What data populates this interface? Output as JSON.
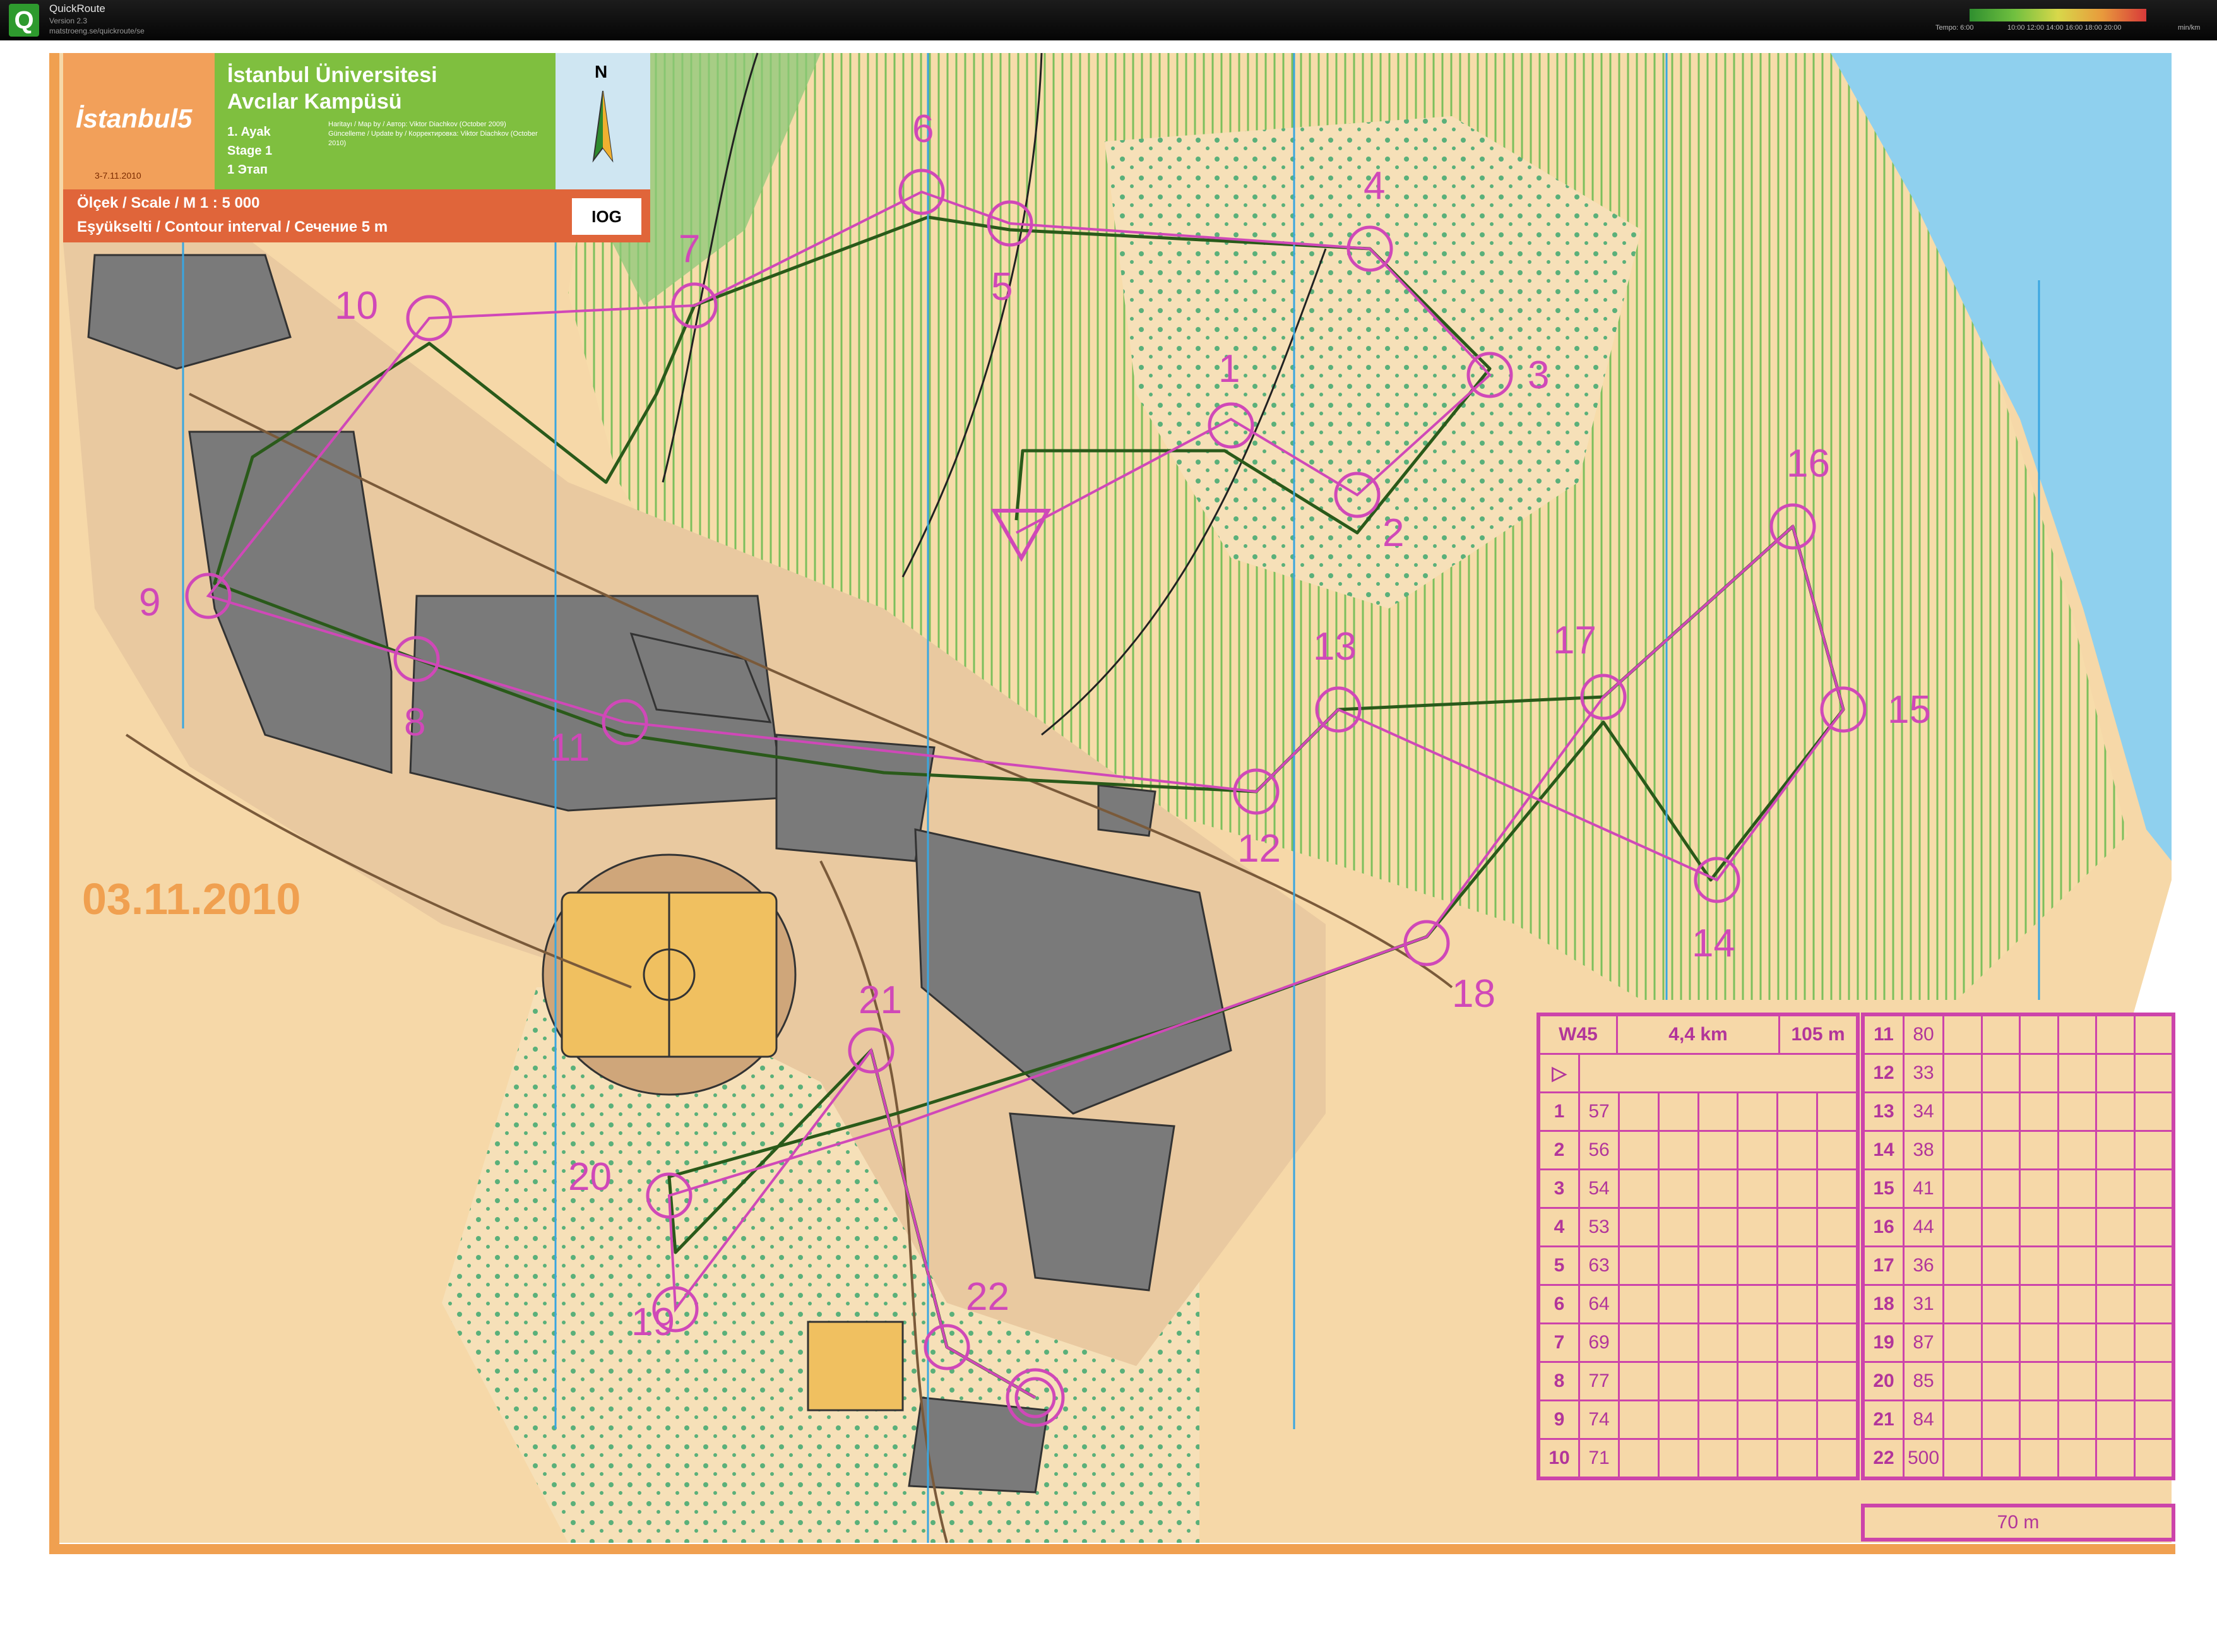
{
  "app": {
    "logo": "Q",
    "title": "QuickRoute",
    "version": "Version 2.3",
    "url": "matstroeng.se/quickroute/se",
    "pace_label": "Tempo: 6:00",
    "pace_ticks": "10:00 12:00 14:00 16:00 18:00 20:00",
    "pace_unit": "min/km"
  },
  "title_block": {
    "event_logo_text": "İstanbul5",
    "event_logo_dates": "3-7.11.2010",
    "map_title_line1": "İstanbul Üniversitesi",
    "map_title_line2": "Avcılar Kampüsü",
    "stage_line1": "1. Ayak",
    "stage_line2": "Stage 1",
    "stage_line3": "1 Этап",
    "credits_line1": "Haritayı / Map by / Автор: Viktor Diachkov (October 2009)",
    "credits_line2": "Güncelleme / Update by / Корректировка: Viktor Diachkov (October 2010)",
    "north_letter": "N",
    "scale_label": "Ölçek / Scale / M   1 : 5 000",
    "contour_label": "Eşyükselti / Contour interval / Сечение   5 m",
    "sponsor": "IOG"
  },
  "map_date": "03.11.2010",
  "colors": {
    "course": "#d048b8",
    "route": "#2a5a1a",
    "building": "#7a7a7a",
    "field": "#f0c060",
    "open_land": "#f6d8a8",
    "forest_green": "#8cc878",
    "water": "#7fc8ec",
    "border_orange": "#f0a050"
  },
  "controls": [
    {
      "label": "1"
    },
    {
      "label": "2"
    },
    {
      "label": "3"
    },
    {
      "label": "4"
    },
    {
      "label": "5"
    },
    {
      "label": "6"
    },
    {
      "label": "7"
    },
    {
      "label": "8"
    },
    {
      "label": "9"
    },
    {
      "label": "10"
    },
    {
      "label": "11"
    },
    {
      "label": "12"
    },
    {
      "label": "13"
    },
    {
      "label": "14"
    },
    {
      "label": "15"
    },
    {
      "label": "16"
    },
    {
      "label": "17"
    },
    {
      "label": "18"
    },
    {
      "label": "19"
    },
    {
      "label": "20"
    },
    {
      "label": "21"
    },
    {
      "label": "22"
    }
  ],
  "description": {
    "class": "W45",
    "length": "4,4 km",
    "climb": "105 m",
    "rows_left": [
      {
        "no": "1",
        "code": "57"
      },
      {
        "no": "2",
        "code": "56"
      },
      {
        "no": "3",
        "code": "54"
      },
      {
        "no": "4",
        "code": "53"
      },
      {
        "no": "5",
        "code": "63"
      },
      {
        "no": "6",
        "code": "64"
      },
      {
        "no": "7",
        "code": "69"
      },
      {
        "no": "8",
        "code": "77"
      },
      {
        "no": "9",
        "code": "74"
      },
      {
        "no": "10",
        "code": "71"
      }
    ],
    "rows_right": [
      {
        "no": "11",
        "code": "80"
      },
      {
        "no": "12",
        "code": "33"
      },
      {
        "no": "13",
        "code": "34"
      },
      {
        "no": "14",
        "code": "38"
      },
      {
        "no": "15",
        "code": "41"
      },
      {
        "no": "16",
        "code": "44"
      },
      {
        "no": "17",
        "code": "36"
      },
      {
        "no": "18",
        "code": "31"
      },
      {
        "no": "19",
        "code": "87"
      },
      {
        "no": "20",
        "code": "85"
      },
      {
        "no": "21",
        "code": "84"
      },
      {
        "no": "22",
        "code": "500"
      }
    ],
    "finish": "70 m"
  }
}
